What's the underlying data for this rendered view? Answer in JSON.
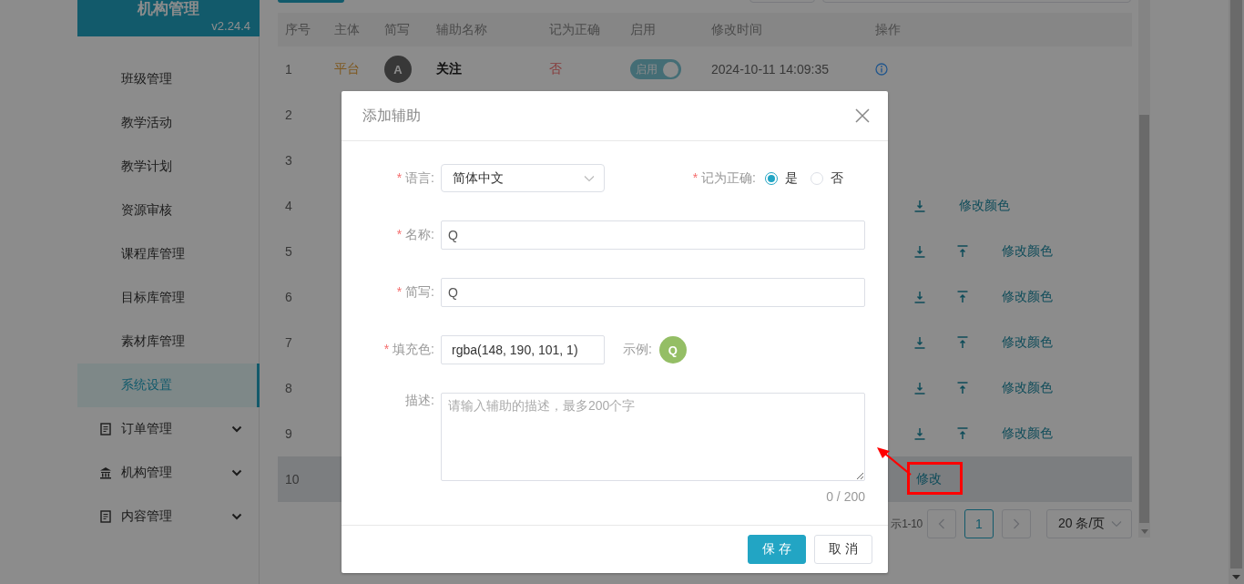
{
  "sidebar": {
    "header": {
      "title": "机构管理",
      "version": "v2.24.4"
    },
    "items": [
      {
        "kind": "sub",
        "label": "班级管理",
        "selected": false
      },
      {
        "kind": "sub",
        "label": "教学活动",
        "selected": false
      },
      {
        "kind": "sub",
        "label": "教学计划",
        "selected": false
      },
      {
        "kind": "sub",
        "label": "资源审核",
        "selected": false
      },
      {
        "kind": "sub",
        "label": "课程库管理",
        "selected": false
      },
      {
        "kind": "sub",
        "label": "目标库管理",
        "selected": false
      },
      {
        "kind": "sub",
        "label": "素材库管理",
        "selected": false
      },
      {
        "kind": "sub",
        "label": "系统设置",
        "selected": true
      },
      {
        "kind": "group",
        "label": "订单管理",
        "selected": false,
        "expanded": false
      },
      {
        "kind": "group",
        "label": "机构管理",
        "selected": false,
        "expanded": false
      },
      {
        "kind": "group",
        "label": "内容管理",
        "selected": false,
        "expanded": false
      }
    ]
  },
  "table": {
    "columns": [
      "序号",
      "主体",
      "简写",
      "辅助名称",
      "记为正确",
      "启用",
      "修改时间",
      "操作"
    ],
    "rows": [
      {
        "number": "1",
        "subject": "平台",
        "abbr": "A",
        "name": "关注",
        "correct": false,
        "correct_label": "否",
        "enabled": true,
        "enabled_label": "启用",
        "modified": "2024-10-11 14:09:35",
        "highlighted": false,
        "actions": [
          {
            "kind": "info"
          }
        ]
      },
      {
        "number": "2",
        "highlighted": false
      },
      {
        "number": "3",
        "highlighted": false
      },
      {
        "number": "4",
        "highlighted": false,
        "actions": [
          {
            "kind": "download"
          },
          {
            "kind": "link",
            "label": "修改颜色"
          }
        ]
      },
      {
        "number": "5",
        "highlighted": false,
        "actions": [
          {
            "kind": "download"
          },
          {
            "kind": "upload"
          },
          {
            "kind": "link",
            "label": "修改颜色"
          }
        ]
      },
      {
        "number": "6",
        "highlighted": false,
        "actions": [
          {
            "kind": "download"
          },
          {
            "kind": "upload"
          },
          {
            "kind": "link",
            "label": "修改颜色"
          }
        ]
      },
      {
        "number": "7",
        "highlighted": false,
        "actions": [
          {
            "kind": "download"
          },
          {
            "kind": "upload"
          },
          {
            "kind": "link",
            "label": "修改颜色"
          }
        ]
      },
      {
        "number": "8",
        "highlighted": false,
        "actions": [
          {
            "kind": "download"
          },
          {
            "kind": "upload"
          },
          {
            "kind": "link",
            "label": "修改颜色"
          }
        ]
      },
      {
        "number": "9",
        "highlighted": false,
        "actions": [
          {
            "kind": "download"
          },
          {
            "kind": "upload"
          },
          {
            "kind": "link",
            "label": "修改颜色"
          }
        ]
      },
      {
        "number": "10",
        "highlighted": true,
        "actions": [
          {
            "kind": "link",
            "label": "修改"
          }
        ]
      }
    ]
  },
  "pagination": {
    "range": "示1-10",
    "pages": [
      {
        "label": "1",
        "selected": true
      }
    ],
    "page_size": "20 条/页"
  },
  "dialog": {
    "title": "添加辅助",
    "language": {
      "asterisk": "*",
      "label": "语言:",
      "value": "简体中文"
    },
    "correct": {
      "asterisk": "*",
      "label": "记为正确:",
      "options": [
        {
          "label": "是",
          "selected": true
        },
        {
          "label": "否",
          "selected": false
        }
      ]
    },
    "name": {
      "asterisk": "*",
      "label": "名称:",
      "value": "Q"
    },
    "abbr": {
      "asterisk": "*",
      "label": "简写:",
      "value": "Q"
    },
    "fill": {
      "asterisk": "*",
      "label": "填充色:",
      "value": "rgba(148, 190, 101, 1)",
      "sample_label": "示例:",
      "sample": "Q",
      "color": "#94be65"
    },
    "description": {
      "label": "描述:",
      "placeholder": "请输入辅助的描述，最多200个字",
      "counter": "0 / 200"
    },
    "buttons": [
      {
        "kind": "primary",
        "label": "保存"
      },
      {
        "kind": "default",
        "label": "取消"
      }
    ]
  },
  "annotation": {
    "kind": "callout"
  }
}
